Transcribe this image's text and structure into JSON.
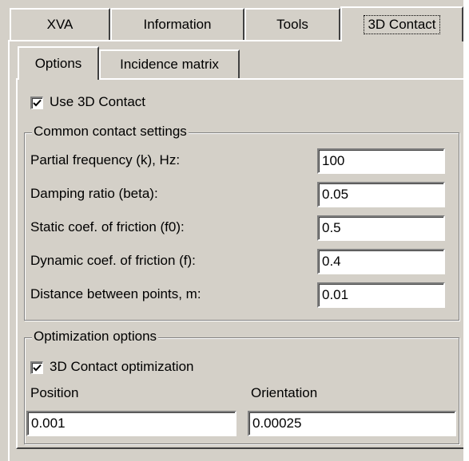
{
  "top_tabs": [
    "XVA",
    "Information",
    "Tools",
    "3D Contact"
  ],
  "inner_tabs": [
    "Options",
    "Incidence matrix"
  ],
  "use_3d_contact": {
    "label": "Use 3D Contact",
    "checked": true
  },
  "common_settings": {
    "title": "Common contact settings",
    "rows": [
      {
        "label": "Partial frequency (k), Hz:",
        "value": "100"
      },
      {
        "label": "Damping ratio (beta):",
        "value": "0.05"
      },
      {
        "label": "Static coef. of friction (f0):",
        "value": "0.5"
      },
      {
        "label": "Dynamic coef. of friction (f):",
        "value": "0.4"
      },
      {
        "label": "Distance between points, m:",
        "value": "0.01"
      }
    ]
  },
  "optimization": {
    "title": "Optimization options",
    "checkbox_label": "3D Contact optimization",
    "checked": true,
    "position_label": "Position",
    "position_value": "0.001",
    "orientation_label": "Orientation",
    "orientation_value": "0.00025"
  }
}
